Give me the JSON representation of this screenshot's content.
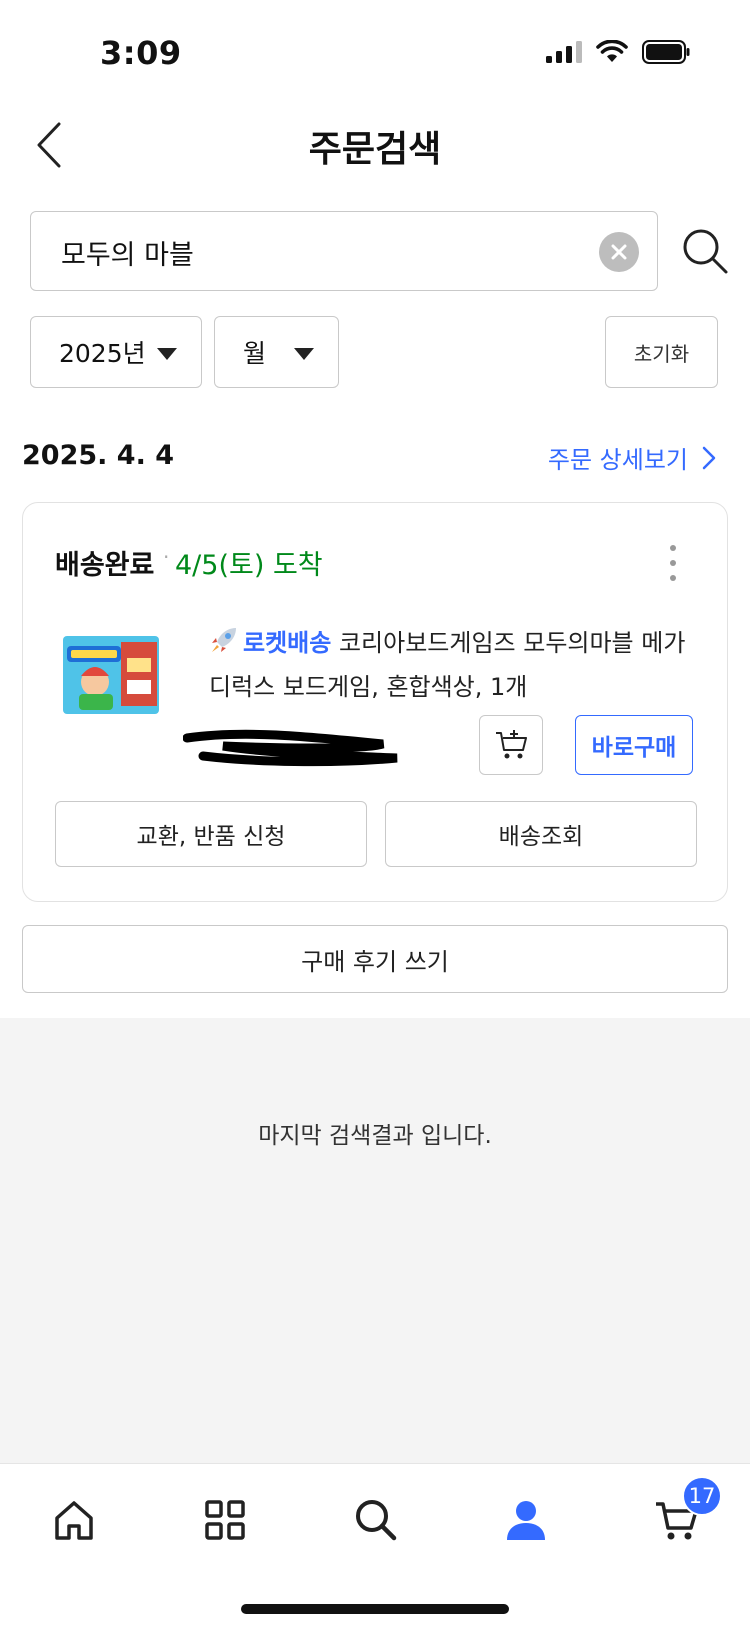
{
  "status_bar": {
    "time": "3:09"
  },
  "header": {
    "title": "주문검색"
  },
  "search": {
    "value": "모두의 마블"
  },
  "filters": {
    "year": "2025년",
    "month": "월",
    "reset_label": "초기화"
  },
  "order": {
    "date": "2025. 4. 4",
    "detail_link": "주문 상세보기",
    "status": "배송완료",
    "separator": "·",
    "arrival": "4/5(토) 도착",
    "delivery_badge": "로켓배송",
    "product_name": "코리아보드게임즈 모두의마블 메가 디럭스 보드게임, 혼합색상, 1개",
    "buy_now_label": "바로구매",
    "exchange_label": "교환, 반품 신청",
    "tracking_label": "배송조회"
  },
  "review_label": "구매 후기 쓰기",
  "end_message": "마지막 검색결과 입니다.",
  "bottom_nav": {
    "cart_count": "17"
  },
  "colors": {
    "accent": "#346aff",
    "arrival_green": "#00891a",
    "background_gray": "#f4f4f4"
  },
  "icons": [
    "back-arrow-icon",
    "clear-icon",
    "search-icon",
    "chevron-right-icon",
    "more-vertical-icon",
    "rocket-icon",
    "cart-add-icon",
    "home-icon",
    "category-icon",
    "user-icon",
    "cart-icon"
  ]
}
